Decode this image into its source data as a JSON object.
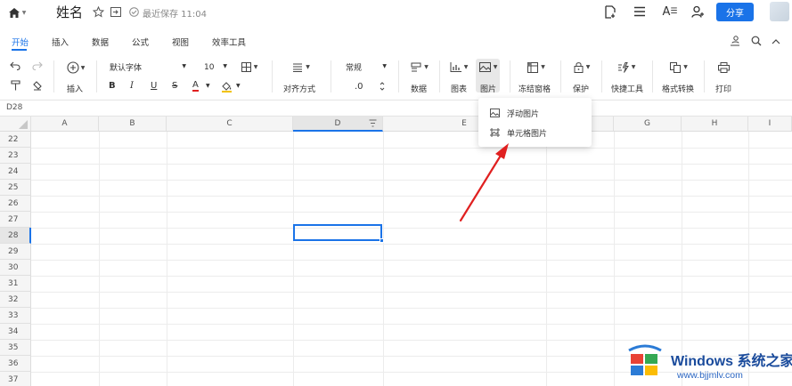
{
  "app": {
    "doc_title": "姓名",
    "save_status": "最近保存 11:04",
    "share_label": "分享"
  },
  "tabs": [
    {
      "label": "开始",
      "active": true
    },
    {
      "label": "插入"
    },
    {
      "label": "数据"
    },
    {
      "label": "公式"
    },
    {
      "label": "视图"
    },
    {
      "label": "效率工具"
    }
  ],
  "toolbar": {
    "insert_label": "插入",
    "font_name": "默认字体",
    "font_size": "10",
    "align_label": "对齐方式",
    "number_format": "常规",
    "decimal_label": ".0",
    "data_label": "数据",
    "chart_label": "图表",
    "image_label": "图片",
    "freeze_label": "冻结窗格",
    "protect_label": "保护",
    "quick_tools_label": "快捷工具",
    "format_convert_label": "格式转换",
    "print_label": "打印",
    "bold": "B",
    "italic": "I",
    "underline": "U",
    "strike": "S",
    "font_color": "A"
  },
  "formula_bar": {
    "cell_ref": "D28"
  },
  "grid": {
    "columns": [
      "A",
      "B",
      "C",
      "D",
      "E",
      "F",
      "G",
      "H",
      "I"
    ],
    "rows": [
      "22",
      "23",
      "24",
      "25",
      "26",
      "27",
      "28",
      "29",
      "30",
      "31",
      "32",
      "33",
      "34",
      "35",
      "36",
      "37"
    ],
    "selected_column": "D",
    "selected_row": "28"
  },
  "image_menu": {
    "items": [
      {
        "label": "浮动图片",
        "icon": "floating-image-icon"
      },
      {
        "label": "单元格图片",
        "icon": "cell-image-icon"
      }
    ]
  },
  "watermark": {
    "title": "Windows 系统之家",
    "url": "www.bjjmlv.com"
  },
  "colors": {
    "accent": "#1a73e8",
    "arrow": "#e02020"
  }
}
